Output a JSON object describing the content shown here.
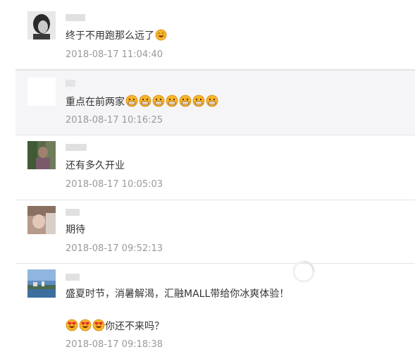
{
  "comments": [
    {
      "text": "终于不用跑那么远了",
      "emojis": [
        "grin-squint-emoji"
      ],
      "time": "2018-08-17 11:04:40",
      "highlighted": false
    },
    {
      "text": "重点在前两家",
      "emojis": [
        "grin-emoji",
        "grin-emoji",
        "grin-emoji",
        "grin-emoji",
        "grin-emoji",
        "grin-emoji",
        "grin-emoji"
      ],
      "time": "2018-08-17 10:16:25",
      "highlighted": true
    },
    {
      "text": "还有多久开业",
      "emojis": [],
      "time": "2018-08-17 10:05:03",
      "highlighted": false
    },
    {
      "text": "期待",
      "emojis": [],
      "time": "2018-08-17 09:52:13",
      "highlighted": false
    },
    {
      "text": "盛夏时节，消暑解渴，汇融MALL带给你冰爽体验！",
      "text2": "你还不来吗？",
      "emojis2": [
        "heart-eyes-emoji",
        "heart-eyes-emoji",
        "heart-eyes-emoji"
      ],
      "time": "2018-08-17 09:18:38",
      "highlighted": false
    }
  ],
  "colors": {
    "time": "#999999",
    "highlight_bg": "#f5f5f7",
    "emoji_face": "#f7b52b"
  }
}
